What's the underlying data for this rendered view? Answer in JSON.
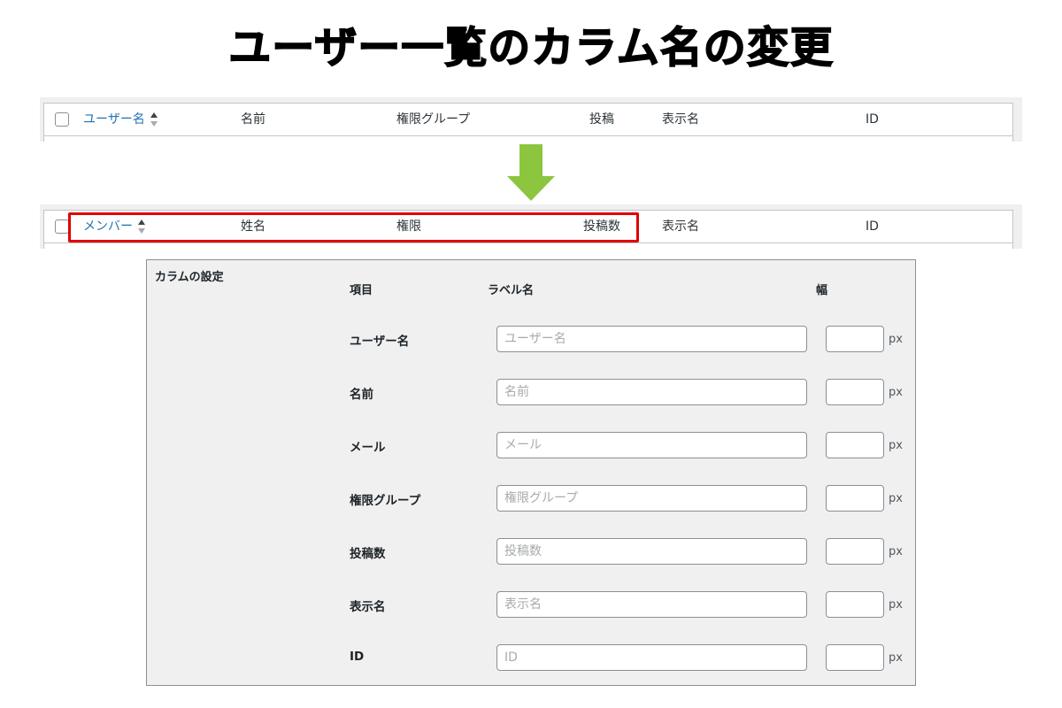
{
  "title": "ユーザー一覧のカラム名の変更",
  "before_columns": {
    "username": "ユーザー名",
    "name": "名前",
    "role": "権限グループ",
    "posts": "投稿",
    "display_name": "表示名",
    "id": "ID"
  },
  "after_columns": {
    "username": "メンバー",
    "name": "姓名",
    "role": "権限",
    "posts": "投稿数",
    "display_name": "表示名",
    "id": "ID"
  },
  "settings": {
    "section_label": "カラムの設定",
    "header_item": "項目",
    "header_label": "ラベル名",
    "header_width": "幅",
    "unit": "px",
    "rows": [
      {
        "item": "ユーザー名",
        "placeholder": "ユーザー名"
      },
      {
        "item": "名前",
        "placeholder": "名前"
      },
      {
        "item": "メール",
        "placeholder": "メール"
      },
      {
        "item": "権限グループ",
        "placeholder": "権限グループ"
      },
      {
        "item": "投稿数",
        "placeholder": "投稿数"
      },
      {
        "item": "表示名",
        "placeholder": "表示名"
      },
      {
        "item": "ID",
        "placeholder": "ID"
      }
    ]
  },
  "colors": {
    "link": "#2271b1",
    "highlight": "#e00000",
    "arrow": "#8cc63f"
  }
}
